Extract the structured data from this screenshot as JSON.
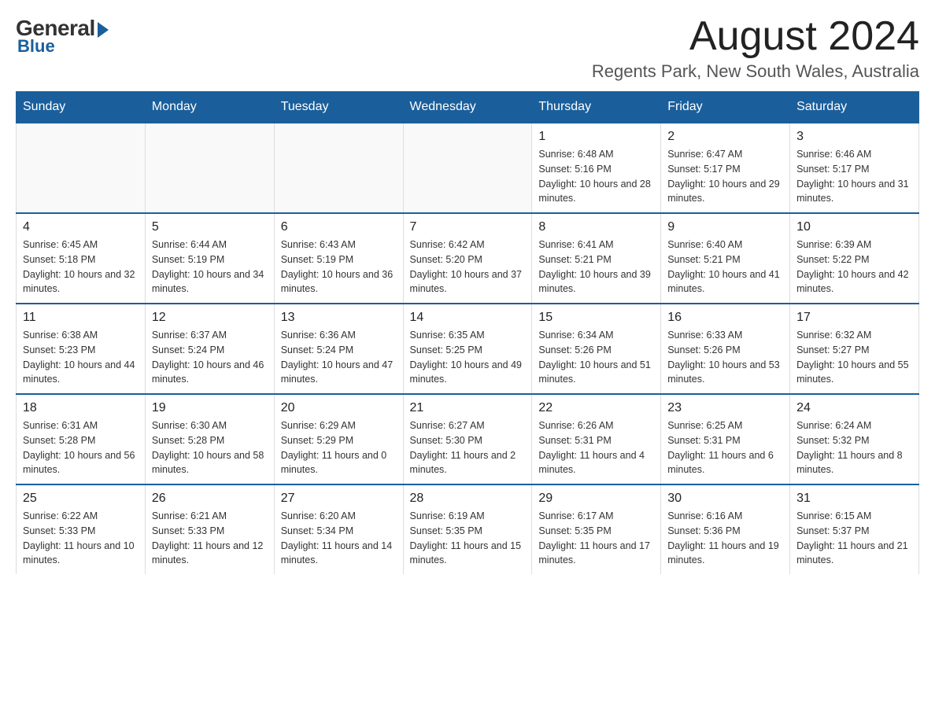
{
  "logo": {
    "general": "General",
    "blue": "Blue"
  },
  "title": "August 2024",
  "location": "Regents Park, New South Wales, Australia",
  "days_of_week": [
    "Sunday",
    "Monday",
    "Tuesday",
    "Wednesday",
    "Thursday",
    "Friday",
    "Saturday"
  ],
  "weeks": [
    [
      {
        "day": "",
        "sunrise": "",
        "sunset": "",
        "daylight": ""
      },
      {
        "day": "",
        "sunrise": "",
        "sunset": "",
        "daylight": ""
      },
      {
        "day": "",
        "sunrise": "",
        "sunset": "",
        "daylight": ""
      },
      {
        "day": "",
        "sunrise": "",
        "sunset": "",
        "daylight": ""
      },
      {
        "day": "1",
        "sunrise": "Sunrise: 6:48 AM",
        "sunset": "Sunset: 5:16 PM",
        "daylight": "Daylight: 10 hours and 28 minutes."
      },
      {
        "day": "2",
        "sunrise": "Sunrise: 6:47 AM",
        "sunset": "Sunset: 5:17 PM",
        "daylight": "Daylight: 10 hours and 29 minutes."
      },
      {
        "day": "3",
        "sunrise": "Sunrise: 6:46 AM",
        "sunset": "Sunset: 5:17 PM",
        "daylight": "Daylight: 10 hours and 31 minutes."
      }
    ],
    [
      {
        "day": "4",
        "sunrise": "Sunrise: 6:45 AM",
        "sunset": "Sunset: 5:18 PM",
        "daylight": "Daylight: 10 hours and 32 minutes."
      },
      {
        "day": "5",
        "sunrise": "Sunrise: 6:44 AM",
        "sunset": "Sunset: 5:19 PM",
        "daylight": "Daylight: 10 hours and 34 minutes."
      },
      {
        "day": "6",
        "sunrise": "Sunrise: 6:43 AM",
        "sunset": "Sunset: 5:19 PM",
        "daylight": "Daylight: 10 hours and 36 minutes."
      },
      {
        "day": "7",
        "sunrise": "Sunrise: 6:42 AM",
        "sunset": "Sunset: 5:20 PM",
        "daylight": "Daylight: 10 hours and 37 minutes."
      },
      {
        "day": "8",
        "sunrise": "Sunrise: 6:41 AM",
        "sunset": "Sunset: 5:21 PM",
        "daylight": "Daylight: 10 hours and 39 minutes."
      },
      {
        "day": "9",
        "sunrise": "Sunrise: 6:40 AM",
        "sunset": "Sunset: 5:21 PM",
        "daylight": "Daylight: 10 hours and 41 minutes."
      },
      {
        "day": "10",
        "sunrise": "Sunrise: 6:39 AM",
        "sunset": "Sunset: 5:22 PM",
        "daylight": "Daylight: 10 hours and 42 minutes."
      }
    ],
    [
      {
        "day": "11",
        "sunrise": "Sunrise: 6:38 AM",
        "sunset": "Sunset: 5:23 PM",
        "daylight": "Daylight: 10 hours and 44 minutes."
      },
      {
        "day": "12",
        "sunrise": "Sunrise: 6:37 AM",
        "sunset": "Sunset: 5:24 PM",
        "daylight": "Daylight: 10 hours and 46 minutes."
      },
      {
        "day": "13",
        "sunrise": "Sunrise: 6:36 AM",
        "sunset": "Sunset: 5:24 PM",
        "daylight": "Daylight: 10 hours and 47 minutes."
      },
      {
        "day": "14",
        "sunrise": "Sunrise: 6:35 AM",
        "sunset": "Sunset: 5:25 PM",
        "daylight": "Daylight: 10 hours and 49 minutes."
      },
      {
        "day": "15",
        "sunrise": "Sunrise: 6:34 AM",
        "sunset": "Sunset: 5:26 PM",
        "daylight": "Daylight: 10 hours and 51 minutes."
      },
      {
        "day": "16",
        "sunrise": "Sunrise: 6:33 AM",
        "sunset": "Sunset: 5:26 PM",
        "daylight": "Daylight: 10 hours and 53 minutes."
      },
      {
        "day": "17",
        "sunrise": "Sunrise: 6:32 AM",
        "sunset": "Sunset: 5:27 PM",
        "daylight": "Daylight: 10 hours and 55 minutes."
      }
    ],
    [
      {
        "day": "18",
        "sunrise": "Sunrise: 6:31 AM",
        "sunset": "Sunset: 5:28 PM",
        "daylight": "Daylight: 10 hours and 56 minutes."
      },
      {
        "day": "19",
        "sunrise": "Sunrise: 6:30 AM",
        "sunset": "Sunset: 5:28 PM",
        "daylight": "Daylight: 10 hours and 58 minutes."
      },
      {
        "day": "20",
        "sunrise": "Sunrise: 6:29 AM",
        "sunset": "Sunset: 5:29 PM",
        "daylight": "Daylight: 11 hours and 0 minutes."
      },
      {
        "day": "21",
        "sunrise": "Sunrise: 6:27 AM",
        "sunset": "Sunset: 5:30 PM",
        "daylight": "Daylight: 11 hours and 2 minutes."
      },
      {
        "day": "22",
        "sunrise": "Sunrise: 6:26 AM",
        "sunset": "Sunset: 5:31 PM",
        "daylight": "Daylight: 11 hours and 4 minutes."
      },
      {
        "day": "23",
        "sunrise": "Sunrise: 6:25 AM",
        "sunset": "Sunset: 5:31 PM",
        "daylight": "Daylight: 11 hours and 6 minutes."
      },
      {
        "day": "24",
        "sunrise": "Sunrise: 6:24 AM",
        "sunset": "Sunset: 5:32 PM",
        "daylight": "Daylight: 11 hours and 8 minutes."
      }
    ],
    [
      {
        "day": "25",
        "sunrise": "Sunrise: 6:22 AM",
        "sunset": "Sunset: 5:33 PM",
        "daylight": "Daylight: 11 hours and 10 minutes."
      },
      {
        "day": "26",
        "sunrise": "Sunrise: 6:21 AM",
        "sunset": "Sunset: 5:33 PM",
        "daylight": "Daylight: 11 hours and 12 minutes."
      },
      {
        "day": "27",
        "sunrise": "Sunrise: 6:20 AM",
        "sunset": "Sunset: 5:34 PM",
        "daylight": "Daylight: 11 hours and 14 minutes."
      },
      {
        "day": "28",
        "sunrise": "Sunrise: 6:19 AM",
        "sunset": "Sunset: 5:35 PM",
        "daylight": "Daylight: 11 hours and 15 minutes."
      },
      {
        "day": "29",
        "sunrise": "Sunrise: 6:17 AM",
        "sunset": "Sunset: 5:35 PM",
        "daylight": "Daylight: 11 hours and 17 minutes."
      },
      {
        "day": "30",
        "sunrise": "Sunrise: 6:16 AM",
        "sunset": "Sunset: 5:36 PM",
        "daylight": "Daylight: 11 hours and 19 minutes."
      },
      {
        "day": "31",
        "sunrise": "Sunrise: 6:15 AM",
        "sunset": "Sunset: 5:37 PM",
        "daylight": "Daylight: 11 hours and 21 minutes."
      }
    ]
  ]
}
